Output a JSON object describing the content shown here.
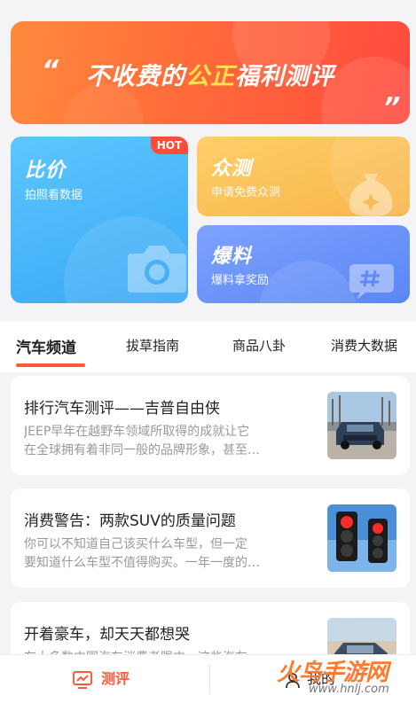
{
  "banner": {
    "quote_open": "“",
    "quote_close": "”",
    "title_part1": "不收费的",
    "title_highlight": "公正",
    "title_part2": "福利测评"
  },
  "cards": {
    "compare": {
      "title": "比价",
      "subtitle": "拍照看数据",
      "badge": "HOT",
      "icon": "camera-icon",
      "color": "#3aa7f5"
    },
    "test": {
      "title": "众测",
      "subtitle": "申请免费众测",
      "icon": "moneybag-icon",
      "color": "#f8b54a"
    },
    "tip": {
      "title": "爆料",
      "subtitle": "爆料拿奖励",
      "icon": "hash-icon",
      "color": "#5a86f5"
    }
  },
  "tabs": [
    {
      "label": "汽车频道",
      "active": true
    },
    {
      "label": "拔草指南",
      "active": false
    },
    {
      "label": "商品八卦",
      "active": false
    },
    {
      "label": "消费大数据",
      "active": false
    }
  ],
  "articles": [
    {
      "title": "排行汽车测评——吉普自由侠",
      "desc_line1": "JEEP早年在越野车领域所取得的成就让它",
      "desc_line2": "在全球拥有着非同一般的品牌形象，甚至…",
      "thumb": "suv-photo"
    },
    {
      "title": "消费警告：两款SUV的质量问题",
      "desc_line1": "你可以不知道自己该买什么车型，但一定",
      "desc_line2": "要知道什么车型不值得购买。一年一度的…",
      "thumb": "traffic-light-photo"
    },
    {
      "title": "开着豪车，却天天都想哭",
      "desc_line1": "在大多数中国汽车消费者眼中，这些汽车",
      "desc_line2": "",
      "thumb": "car-photo"
    }
  ],
  "bottom_nav": {
    "test_label": "测评",
    "mine_label": "我的",
    "accent": "#ff5a3a"
  },
  "watermark": {
    "text": "火鸟手游网",
    "url": "www.hnlj.com"
  }
}
